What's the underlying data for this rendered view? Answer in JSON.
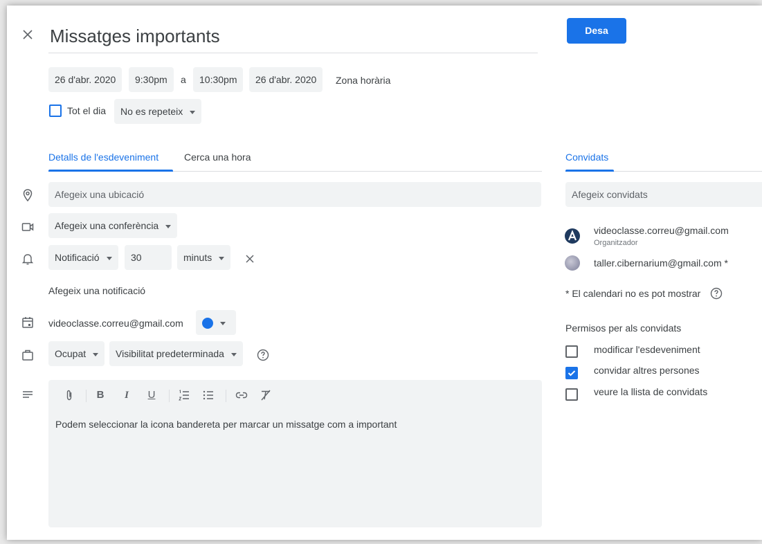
{
  "header": {
    "close_icon": "close-icon",
    "title": "Missatges importants",
    "save_label": "Desa"
  },
  "datetime": {
    "start_date": "26 d'abr. 2020",
    "start_time": "9:30pm",
    "separator": "a",
    "end_time": "10:30pm",
    "end_date": "26 d'abr. 2020",
    "timezone": "Zona horària",
    "all_day_label": "Tot el dia",
    "all_day_checked": false,
    "repeat": "No es repeteix"
  },
  "tabs": {
    "details": "Detalls de l'esdeveniment",
    "find_time": "Cerca una hora",
    "active": "details"
  },
  "details": {
    "location_placeholder": "Afegeix una ubicació",
    "conference_label": "Afegeix una conferència",
    "notification_type": "Notificació",
    "notification_value": "30",
    "notification_unit": "minuts",
    "add_notification": "Afegeix una notificació",
    "calendar_account": "videoclasse.correu@gmail.com",
    "calendar_color": "#1a73e8",
    "availability": "Ocupat",
    "visibility": "Visibilitat predeterminada",
    "toolbar": {
      "bold": "B",
      "italic": "I",
      "underline": "U"
    },
    "description": "Podem seleccionar la icona bandereta per marcar un missatge com a important"
  },
  "guests": {
    "tab_label": "Convidats",
    "input_placeholder": "Afegeix convidats",
    "list": [
      {
        "email": "videoclasse.correu@gmail.com",
        "role": "Organitzador"
      },
      {
        "email": "taller.cibernarium@gmail.com *",
        "role": ""
      }
    ],
    "calendar_note": "* El calendari no es pot mostrar",
    "permissions_title": "Permisos per als convidats",
    "permissions": [
      {
        "label": "modificar l'esdeveniment",
        "checked": false
      },
      {
        "label": "convidar altres persones",
        "checked": true
      },
      {
        "label": "veure la llista de convidats",
        "checked": false
      }
    ]
  },
  "colors": {
    "accent": "#1a73e8",
    "chip_bg": "#f1f3f4",
    "text": "#3c4043",
    "icon": "#5f6368"
  }
}
